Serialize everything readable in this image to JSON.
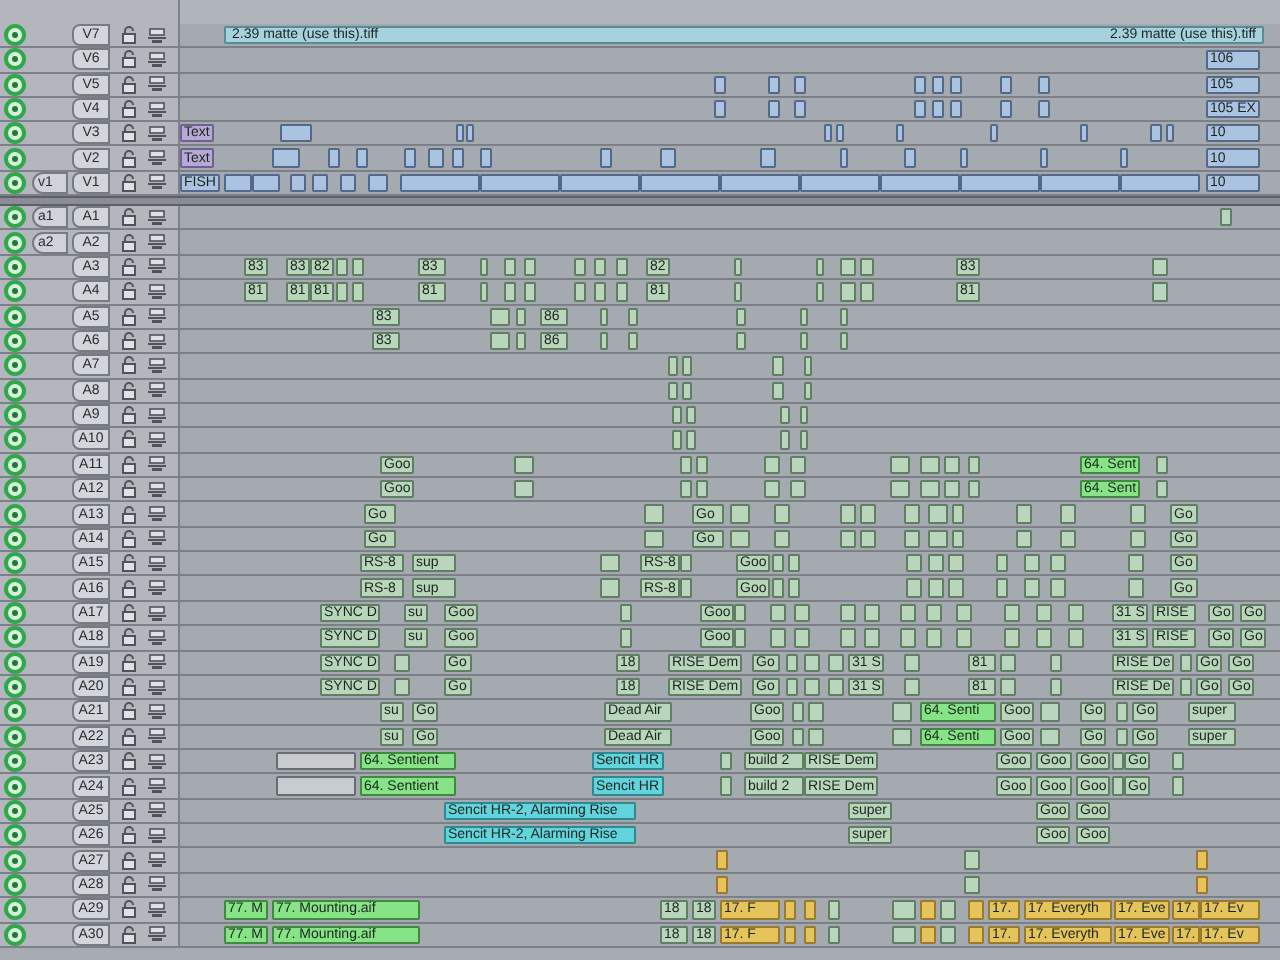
{
  "video_tracks": [
    {
      "label": "V7",
      "enabled": true,
      "locked": false,
      "clips": [
        {
          "labels": [
            "2.39 matte (use this).tiff",
            "2.39 matte (use this).tiff"
          ],
          "kind": "matte"
        }
      ]
    },
    {
      "label": "V6",
      "enabled": true,
      "locked": false,
      "clips": [
        {
          "name": "106",
          "kind": "video"
        }
      ]
    },
    {
      "label": "V5",
      "enabled": true,
      "locked": false,
      "clips": [
        {
          "kind": "video"
        },
        {
          "kind": "video"
        },
        {
          "kind": "video"
        },
        {
          "kind": "video"
        },
        {
          "kind": "video"
        },
        {
          "kind": "video"
        },
        {
          "kind": "video"
        },
        {
          "kind": "video"
        },
        {
          "name": "105",
          "kind": "video"
        }
      ]
    },
    {
      "label": "V4",
      "enabled": true,
      "locked": false,
      "clips": [
        {
          "kind": "video"
        },
        {
          "kind": "video"
        },
        {
          "kind": "video"
        },
        {
          "kind": "video"
        },
        {
          "kind": "video"
        },
        {
          "kind": "video"
        },
        {
          "kind": "video"
        },
        {
          "kind": "video"
        },
        {
          "name": "105 EX",
          "kind": "video"
        }
      ]
    },
    {
      "label": "V3",
      "enabled": true,
      "locked": false,
      "clips": [
        {
          "name": "Text",
          "kind": "title"
        },
        {
          "kind": "video"
        },
        {
          "kind": "video"
        },
        {
          "kind": "video"
        },
        {
          "kind": "video"
        },
        {
          "kind": "video"
        },
        {
          "kind": "video"
        },
        {
          "kind": "video"
        },
        {
          "kind": "video"
        },
        {
          "kind": "video"
        },
        {
          "kind": "video"
        },
        {
          "name": "10",
          "kind": "video"
        }
      ]
    },
    {
      "label": "V2",
      "enabled": true,
      "locked": false,
      "clips": [
        {
          "name": "Text",
          "kind": "title"
        },
        {
          "kind": "video"
        },
        {
          "kind": "video"
        },
        {
          "kind": "video"
        },
        {
          "kind": "video"
        },
        {
          "kind": "video"
        },
        {
          "kind": "video"
        },
        {
          "kind": "video"
        },
        {
          "kind": "video"
        },
        {
          "kind": "video"
        },
        {
          "kind": "video"
        },
        {
          "kind": "video"
        },
        {
          "kind": "video"
        },
        {
          "kind": "video"
        },
        {
          "kind": "video"
        },
        {
          "kind": "video"
        },
        {
          "name": "10",
          "kind": "video"
        }
      ]
    },
    {
      "label": "V1",
      "patch": "v1",
      "enabled": true,
      "locked": false,
      "clips": [
        {
          "name": "FISH",
          "kind": "video"
        },
        {
          "kind": "video"
        },
        {
          "kind": "video"
        },
        {
          "kind": "video"
        },
        {
          "kind": "video"
        },
        {
          "kind": "video"
        },
        {
          "kind": "video"
        },
        {
          "kind": "video"
        },
        {
          "kind": "video"
        },
        {
          "kind": "video"
        },
        {
          "kind": "video"
        },
        {
          "kind": "video"
        },
        {
          "kind": "video"
        },
        {
          "kind": "video"
        },
        {
          "kind": "video"
        },
        {
          "kind": "video"
        },
        {
          "kind": "video"
        },
        {
          "name": "10",
          "kind": "video"
        }
      ]
    }
  ],
  "audio_tracks": [
    {
      "label": "A1",
      "patch": "a1",
      "enabled": true,
      "locked": false,
      "clips": [
        {
          "kind": "audio"
        }
      ]
    },
    {
      "label": "A2",
      "patch": "a2",
      "enabled": true,
      "locked": false
    },
    {
      "label": "A3",
      "enabled": true,
      "locked": false,
      "clips": [
        {
          "name": "83",
          "kind": "audio"
        },
        {
          "name": "83",
          "kind": "audio"
        },
        {
          "name": "82",
          "kind": "audio"
        },
        {
          "kind": "audio"
        },
        {
          "kind": "audio"
        },
        {
          "name": "83",
          "kind": "audio"
        },
        {
          "kind": "audio"
        },
        {
          "kind": "audio"
        },
        {
          "kind": "audio"
        },
        {
          "kind": "audio"
        },
        {
          "kind": "audio"
        },
        {
          "kind": "audio"
        },
        {
          "name": "82",
          "kind": "audio"
        },
        {
          "kind": "audio"
        },
        {
          "kind": "audio"
        },
        {
          "kind": "audio"
        },
        {
          "kind": "audio"
        },
        {
          "name": "83",
          "kind": "audio"
        },
        {
          "kind": "audio"
        }
      ]
    },
    {
      "label": "A4",
      "enabled": true,
      "locked": false,
      "clips": [
        {
          "name": "81",
          "kind": "audio"
        },
        {
          "name": "81",
          "kind": "audio"
        },
        {
          "name": "81",
          "kind": "audio"
        },
        {
          "kind": "audio"
        },
        {
          "kind": "audio"
        },
        {
          "name": "81",
          "kind": "audio"
        },
        {
          "kind": "audio"
        },
        {
          "kind": "audio"
        },
        {
          "kind": "audio"
        },
        {
          "kind": "audio"
        },
        {
          "kind": "audio"
        },
        {
          "kind": "audio"
        },
        {
          "name": "81",
          "kind": "audio"
        },
        {
          "kind": "audio"
        },
        {
          "kind": "audio"
        },
        {
          "kind": "audio"
        },
        {
          "kind": "audio"
        },
        {
          "name": "81",
          "kind": "audio"
        },
        {
          "kind": "audio"
        }
      ]
    },
    {
      "label": "A5",
      "enabled": true,
      "locked": false,
      "clips": [
        {
          "name": "83",
          "kind": "audio"
        },
        {
          "kind": "audio"
        },
        {
          "kind": "audio"
        },
        {
          "name": "86",
          "kind": "audio"
        },
        {
          "kind": "audio"
        },
        {
          "kind": "audio"
        },
        {
          "kind": "audio"
        },
        {
          "kind": "audio"
        },
        {
          "kind": "audio"
        }
      ]
    },
    {
      "label": "A6",
      "enabled": true,
      "locked": false,
      "clips": [
        {
          "name": "83",
          "kind": "audio"
        },
        {
          "kind": "audio"
        },
        {
          "kind": "audio"
        },
        {
          "name": "86",
          "kind": "audio"
        },
        {
          "kind": "audio"
        },
        {
          "kind": "audio"
        },
        {
          "kind": "audio"
        },
        {
          "kind": "audio"
        },
        {
          "kind": "audio"
        }
      ]
    },
    {
      "label": "A7",
      "enabled": true,
      "locked": false,
      "clips": [
        {
          "kind": "audio"
        },
        {
          "kind": "audio"
        },
        {
          "kind": "audio"
        },
        {
          "kind": "audio"
        }
      ]
    },
    {
      "label": "A8",
      "enabled": true,
      "locked": false,
      "clips": [
        {
          "kind": "audio"
        },
        {
          "kind": "audio"
        },
        {
          "kind": "audio"
        },
        {
          "kind": "audio"
        }
      ]
    },
    {
      "label": "A9",
      "enabled": true,
      "locked": false,
      "clips": [
        {
          "kind": "audio"
        },
        {
          "kind": "audio"
        },
        {
          "kind": "audio"
        },
        {
          "kind": "audio"
        }
      ]
    },
    {
      "label": "A10",
      "enabled": true,
      "locked": false,
      "clips": [
        {
          "kind": "audio"
        },
        {
          "kind": "audio"
        },
        {
          "kind": "audio"
        },
        {
          "kind": "audio"
        }
      ]
    },
    {
      "label": "A11",
      "enabled": true,
      "locked": false,
      "clips": [
        {
          "name": "Goo",
          "kind": "audio"
        },
        {
          "kind": "audio"
        },
        {
          "kind": "audio"
        },
        {
          "kind": "audio"
        },
        {
          "kind": "audio"
        },
        {
          "kind": "audio"
        },
        {
          "kind": "audio"
        },
        {
          "kind": "audio"
        },
        {
          "kind": "audio"
        },
        {
          "kind": "audio"
        },
        {
          "name": "64. Sent",
          "kind": "music"
        },
        {
          "kind": "audio"
        }
      ]
    },
    {
      "label": "A12",
      "enabled": true,
      "locked": false,
      "clips": [
        {
          "name": "Goo",
          "kind": "audio"
        },
        {
          "kind": "audio"
        },
        {
          "kind": "audio"
        },
        {
          "kind": "audio"
        },
        {
          "kind": "audio"
        },
        {
          "kind": "audio"
        },
        {
          "kind": "audio"
        },
        {
          "kind": "audio"
        },
        {
          "kind": "audio"
        },
        {
          "kind": "audio"
        },
        {
          "name": "64. Sent",
          "kind": "music"
        },
        {
          "kind": "audio"
        }
      ]
    },
    {
      "label": "A13",
      "enabled": true,
      "locked": false,
      "clips": [
        {
          "name": "Go",
          "kind": "audio"
        },
        {
          "kind": "audio"
        },
        {
          "name": "Go",
          "kind": "audio"
        },
        {
          "kind": "audio"
        },
        {
          "kind": "audio"
        },
        {
          "kind": "audio"
        },
        {
          "kind": "audio"
        },
        {
          "kind": "audio"
        },
        {
          "kind": "audio"
        },
        {
          "kind": "audio"
        },
        {
          "kind": "audio"
        },
        {
          "kind": "audio"
        },
        {
          "kind": "audio"
        },
        {
          "name": "Go",
          "kind": "audio"
        }
      ]
    },
    {
      "label": "A14",
      "enabled": true,
      "locked": false,
      "clips": [
        {
          "name": "Go",
          "kind": "audio"
        },
        {
          "kind": "audio"
        },
        {
          "name": "Go",
          "kind": "audio"
        },
        {
          "kind": "audio"
        },
        {
          "kind": "audio"
        },
        {
          "kind": "audio"
        },
        {
          "kind": "audio"
        },
        {
          "kind": "audio"
        },
        {
          "kind": "audio"
        },
        {
          "kind": "audio"
        },
        {
          "kind": "audio"
        },
        {
          "kind": "audio"
        },
        {
          "kind": "audio"
        },
        {
          "name": "Go",
          "kind": "audio"
        }
      ]
    },
    {
      "label": "A15",
      "enabled": true,
      "locked": false,
      "clips": [
        {
          "name": "RS-8",
          "kind": "audio"
        },
        {
          "name": "sup",
          "kind": "audio"
        },
        {
          "kind": "audio"
        },
        {
          "name": "RS-8",
          "kind": "audio"
        },
        {
          "kind": "audio"
        },
        {
          "name": "Goo",
          "kind": "audio"
        },
        {
          "kind": "audio"
        },
        {
          "kind": "audio"
        },
        {
          "kind": "audio"
        },
        {
          "kind": "audio"
        },
        {
          "kind": "audio"
        },
        {
          "kind": "audio"
        },
        {
          "kind": "audio"
        },
        {
          "kind": "audio"
        },
        {
          "kind": "audio"
        },
        {
          "name": "Go",
          "kind": "audio"
        }
      ]
    },
    {
      "label": "A16",
      "enabled": true,
      "locked": false,
      "clips": [
        {
          "name": "RS-8",
          "kind": "audio"
        },
        {
          "name": "sup",
          "kind": "audio"
        },
        {
          "kind": "audio"
        },
        {
          "name": "RS-8",
          "kind": "audio"
        },
        {
          "kind": "audio"
        },
        {
          "name": "Goo",
          "kind": "audio"
        },
        {
          "kind": "audio"
        },
        {
          "kind": "audio"
        },
        {
          "kind": "audio"
        },
        {
          "kind": "audio"
        },
        {
          "kind": "audio"
        },
        {
          "kind": "audio"
        },
        {
          "kind": "audio"
        },
        {
          "kind": "audio"
        },
        {
          "kind": "audio"
        },
        {
          "name": "Go",
          "kind": "audio"
        }
      ]
    },
    {
      "label": "A17",
      "enabled": true,
      "locked": false,
      "clips": [
        {
          "name": "SYNC D",
          "kind": "audio"
        },
        {
          "name": "su",
          "kind": "audio"
        },
        {
          "name": "Goo",
          "kind": "audio"
        },
        {
          "kind": "audio"
        },
        {
          "name": "Goo",
          "kind": "audio"
        },
        {
          "kind": "audio"
        },
        {
          "kind": "audio"
        },
        {
          "kind": "audio"
        },
        {
          "kind": "audio"
        },
        {
          "kind": "audio"
        },
        {
          "kind": "audio"
        },
        {
          "kind": "audio"
        },
        {
          "kind": "audio"
        },
        {
          "kind": "audio"
        },
        {
          "kind": "audio"
        },
        {
          "kind": "audio"
        },
        {
          "name": "31 S",
          "kind": "audio"
        },
        {
          "name": "RISE",
          "kind": "audio"
        },
        {
          "name": "Go",
          "kind": "audio"
        },
        {
          "name": "Go",
          "kind": "audio"
        }
      ]
    },
    {
      "label": "A18",
      "enabled": true,
      "locked": false,
      "clips": [
        {
          "name": "SYNC D",
          "kind": "audio"
        },
        {
          "name": "su",
          "kind": "audio"
        },
        {
          "name": "Goo",
          "kind": "audio"
        },
        {
          "kind": "audio"
        },
        {
          "name": "Goo",
          "kind": "audio"
        },
        {
          "kind": "audio"
        },
        {
          "kind": "audio"
        },
        {
          "kind": "audio"
        },
        {
          "kind": "audio"
        },
        {
          "kind": "audio"
        },
        {
          "kind": "audio"
        },
        {
          "kind": "audio"
        },
        {
          "kind": "audio"
        },
        {
          "kind": "audio"
        },
        {
          "kind": "audio"
        },
        {
          "kind": "audio"
        },
        {
          "name": "31 S",
          "kind": "audio"
        },
        {
          "name": "RISE",
          "kind": "audio"
        },
        {
          "name": "Go",
          "kind": "audio"
        },
        {
          "name": "Go",
          "kind": "audio"
        }
      ]
    },
    {
      "label": "A19",
      "enabled": true,
      "locked": false,
      "clips": [
        {
          "name": "SYNC D",
          "kind": "audio"
        },
        {
          "kind": "audio"
        },
        {
          "name": "Go",
          "kind": "audio"
        },
        {
          "name": "18",
          "kind": "audio"
        },
        {
          "name": "RISE Dem",
          "kind": "audio"
        },
        {
          "name": "Go",
          "kind": "audio"
        },
        {
          "kind": "audio"
        },
        {
          "kind": "audio"
        },
        {
          "kind": "audio"
        },
        {
          "name": "31 S",
          "kind": "audio"
        },
        {
          "kind": "audio"
        },
        {
          "name": "81",
          "kind": "audio"
        },
        {
          "kind": "audio"
        },
        {
          "kind": "audio"
        },
        {
          "name": "RISE De",
          "kind": "audio"
        },
        {
          "kind": "audio"
        },
        {
          "name": "Go",
          "kind": "audio"
        },
        {
          "name": "Go",
          "kind": "audio"
        }
      ]
    },
    {
      "label": "A20",
      "enabled": true,
      "locked": false,
      "clips": [
        {
          "name": "SYNC D",
          "kind": "audio"
        },
        {
          "kind": "audio"
        },
        {
          "name": "Go",
          "kind": "audio"
        },
        {
          "name": "18",
          "kind": "audio"
        },
        {
          "name": "RISE Dem",
          "kind": "audio"
        },
        {
          "name": "Go",
          "kind": "audio"
        },
        {
          "kind": "audio"
        },
        {
          "kind": "audio"
        },
        {
          "kind": "audio"
        },
        {
          "name": "31 S",
          "kind": "audio"
        },
        {
          "kind": "audio"
        },
        {
          "name": "81",
          "kind": "audio"
        },
        {
          "kind": "audio"
        },
        {
          "kind": "audio"
        },
        {
          "name": "RISE De",
          "kind": "audio"
        },
        {
          "kind": "audio"
        },
        {
          "name": "Go",
          "kind": "audio"
        },
        {
          "name": "Go",
          "kind": "audio"
        }
      ]
    },
    {
      "label": "A21",
      "enabled": true,
      "locked": false,
      "clips": [
        {
          "name": "su",
          "kind": "audio"
        },
        {
          "name": "Go",
          "kind": "audio"
        },
        {
          "name": "Dead Air",
          "kind": "audio"
        },
        {
          "name": "Goo",
          "kind": "audio"
        },
        {
          "kind": "audio"
        },
        {
          "kind": "audio"
        },
        {
          "kind": "audio"
        },
        {
          "name": "64. Senti",
          "kind": "music"
        },
        {
          "name": "Goo",
          "kind": "audio"
        },
        {
          "kind": "audio"
        },
        {
          "name": "Go",
          "kind": "audio"
        },
        {
          "kind": "audio"
        },
        {
          "name": "Go",
          "kind": "audio"
        },
        {
          "name": "super",
          "kind": "audio"
        }
      ]
    },
    {
      "label": "A22",
      "enabled": true,
      "locked": false,
      "clips": [
        {
          "name": "su",
          "kind": "audio"
        },
        {
          "name": "Go",
          "kind": "audio"
        },
        {
          "name": "Dead Air",
          "kind": "audio"
        },
        {
          "name": "Goo",
          "kind": "audio"
        },
        {
          "kind": "audio"
        },
        {
          "kind": "audio"
        },
        {
          "kind": "audio"
        },
        {
          "name": "64. Senti",
          "kind": "music"
        },
        {
          "name": "Goo",
          "kind": "audio"
        },
        {
          "kind": "audio"
        },
        {
          "name": "Go",
          "kind": "audio"
        },
        {
          "kind": "audio"
        },
        {
          "name": "Go",
          "kind": "audio"
        },
        {
          "name": "super",
          "kind": "audio"
        }
      ]
    },
    {
      "label": "A23",
      "enabled": true,
      "locked": false,
      "clips": [
        {
          "kind": "generator"
        },
        {
          "name": "64. Sentient",
          "kind": "music"
        },
        {
          "name": "Sencit HR",
          "kind": "sfx"
        },
        {
          "kind": "audio"
        },
        {
          "name": "build 2",
          "kind": "audio"
        },
        {
          "name": "RISE Dem",
          "kind": "audio"
        },
        {
          "name": "Goo",
          "kind": "audio"
        },
        {
          "name": "Goo",
          "kind": "audio"
        },
        {
          "name": "Goo",
          "kind": "audio"
        },
        {
          "kind": "audio"
        },
        {
          "name": "Go",
          "kind": "audio"
        },
        {
          "kind": "audio"
        }
      ]
    },
    {
      "label": "A24",
      "enabled": true,
      "locked": false,
      "clips": [
        {
          "kind": "generator"
        },
        {
          "name": "64. Sentient",
          "kind": "music"
        },
        {
          "name": "Sencit HR",
          "kind": "sfx"
        },
        {
          "kind": "audio"
        },
        {
          "name": "build 2",
          "kind": "audio"
        },
        {
          "name": "RISE Dem",
          "kind": "audio"
        },
        {
          "name": "Goo",
          "kind": "audio"
        },
        {
          "name": "Goo",
          "kind": "audio"
        },
        {
          "name": "Goo",
          "kind": "audio"
        },
        {
          "kind": "audio"
        },
        {
          "name": "Go",
          "kind": "audio"
        },
        {
          "kind": "audio"
        }
      ]
    },
    {
      "label": "A25",
      "enabled": true,
      "locked": false,
      "clips": [
        {
          "name": "Sencit HR-2, Alarming Rise",
          "kind": "sfx"
        },
        {
          "name": "super",
          "kind": "audio"
        },
        {
          "name": "Goo",
          "kind": "audio"
        },
        {
          "name": "Goo",
          "kind": "audio"
        }
      ]
    },
    {
      "label": "A26",
      "enabled": true,
      "locked": false,
      "clips": [
        {
          "name": "Sencit HR-2, Alarming Rise",
          "kind": "sfx"
        },
        {
          "name": "super",
          "kind": "audio"
        },
        {
          "name": "Goo",
          "kind": "audio"
        },
        {
          "name": "Goo",
          "kind": "audio"
        }
      ]
    },
    {
      "label": "A27",
      "enabled": true,
      "locked": false,
      "clips": [
        {
          "kind": "song"
        },
        {
          "kind": "audio"
        },
        {
          "kind": "song"
        }
      ]
    },
    {
      "label": "A28",
      "enabled": true,
      "locked": false,
      "clips": [
        {
          "kind": "song"
        },
        {
          "kind": "audio"
        },
        {
          "kind": "song"
        }
      ]
    },
    {
      "label": "A29",
      "enabled": true,
      "locked": false,
      "clips": [
        {
          "name": "77. M",
          "kind": "music"
        },
        {
          "name": "77. Mounting.aif",
          "kind": "music"
        },
        {
          "name": "18",
          "kind": "audio"
        },
        {
          "name": "18",
          "kind": "audio"
        },
        {
          "name": "17. F",
          "kind": "song"
        },
        {
          "kind": "song"
        },
        {
          "kind": "song"
        },
        {
          "kind": "audio"
        },
        {
          "kind": "audio"
        },
        {
          "kind": "song"
        },
        {
          "kind": "audio"
        },
        {
          "kind": "song"
        },
        {
          "name": "17.",
          "kind": "song"
        },
        {
          "name": "17. Everyth",
          "kind": "song"
        },
        {
          "name": "17. Eve",
          "kind": "song"
        },
        {
          "name": "17.",
          "kind": "song"
        },
        {
          "name": "17. Ev",
          "kind": "song"
        }
      ]
    },
    {
      "label": "A30",
      "enabled": true,
      "locked": false,
      "clips": [
        {
          "name": "77. M",
          "kind": "music"
        },
        {
          "name": "77. Mounting.aif",
          "kind": "music"
        },
        {
          "name": "18",
          "kind": "audio"
        },
        {
          "name": "18",
          "kind": "audio"
        },
        {
          "name": "17. F",
          "kind": "song"
        },
        {
          "kind": "song"
        },
        {
          "kind": "song"
        },
        {
          "kind": "audio"
        },
        {
          "kind": "audio"
        },
        {
          "kind": "song"
        },
        {
          "kind": "audio"
        },
        {
          "kind": "song"
        },
        {
          "name": "17.",
          "kind": "song"
        },
        {
          "name": "17. Everyth",
          "kind": "song"
        },
        {
          "name": "17. Eve",
          "kind": "song"
        },
        {
          "name": "17.",
          "kind": "song"
        },
        {
          "name": "17. Ev",
          "kind": "song"
        }
      ]
    }
  ]
}
